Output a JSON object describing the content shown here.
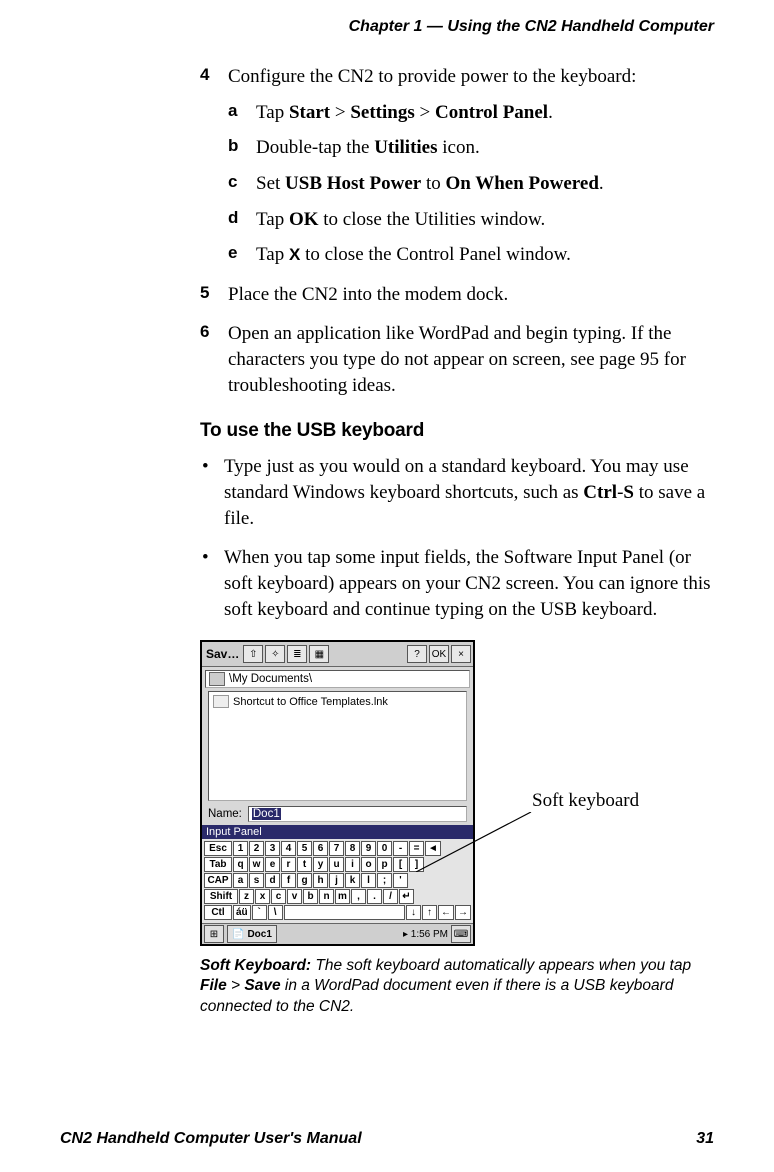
{
  "header": "Chapter 1 — Using the CN2 Handheld Computer",
  "steps": {
    "s4": {
      "num": "4",
      "text_pre": "Configure the CN2 to provide power to the keyboard:",
      "a": {
        "letter": "a",
        "t1": "Tap ",
        "b1": "Start",
        "t2": " > ",
        "b2": "Settings",
        "t3": " > ",
        "b3": "Control Panel",
        "t4": "."
      },
      "b": {
        "letter": "b",
        "t1": "Double-tap the ",
        "b1": "Utilities",
        "t2": " icon."
      },
      "c": {
        "letter": "c",
        "t1": "Set ",
        "b1": "USB Host Power",
        "t2": " to ",
        "b2": "On When Powered",
        "t3": "."
      },
      "d": {
        "letter": "d",
        "t1": "Tap ",
        "b1": "OK",
        "t2": " to close the Utilities window."
      },
      "e": {
        "letter": "e",
        "t1": "Tap ",
        "icon": "X",
        "t2": " to close the Control Panel window."
      }
    },
    "s5": {
      "num": "5",
      "text": "Place the CN2 into the modem dock."
    },
    "s6": {
      "num": "6",
      "text": "Open an application like WordPad and begin typing. If the characters you type do not appear on screen, see page 95 for troubleshooting ideas."
    }
  },
  "section_heading": "To use the USB keyboard",
  "bullets": {
    "b1": {
      "t1": "Type just as you would on a standard keyboard. You may use standard Windows keyboard shortcuts, such as ",
      "bold": "Ctrl",
      "t2": "-",
      "bold2": "S",
      "t3": " to save a file."
    },
    "b2": "When you tap some input fields, the Software Input Panel (or soft keyboard) appears on your CN2 screen. You can ignore this soft keyboard and continue typing on the USB keyboard."
  },
  "callout": "Soft keyboard",
  "screenshot": {
    "title": "Sav…",
    "btn_q": "?",
    "btn_ok": "OK",
    "btn_x": "×",
    "path": "\\My Documents\\",
    "file": "Shortcut to Office Templates.lnk",
    "name_label": "Name:",
    "name_value": "Doc1",
    "sip_title": "Input Panel",
    "keys": {
      "r1": [
        "Esc",
        "1",
        "2",
        "3",
        "4",
        "5",
        "6",
        "7",
        "8",
        "9",
        "0",
        "-",
        "=",
        "◄"
      ],
      "r2": [
        "Tab",
        "q",
        "w",
        "e",
        "r",
        "t",
        "y",
        "u",
        "i",
        "o",
        "p",
        "[",
        "]"
      ],
      "r3": [
        "CAP",
        "a",
        "s",
        "d",
        "f",
        "g",
        "h",
        "j",
        "k",
        "l",
        ";",
        "'"
      ],
      "r4": [
        "Shift",
        "z",
        "x",
        "c",
        "v",
        "b",
        "n",
        "m",
        ",",
        ".",
        "/",
        "↵"
      ],
      "r5": [
        "Ctl",
        "áü",
        "`",
        "\\",
        " ",
        " ",
        "↓",
        "↑",
        "←",
        "→"
      ]
    },
    "task_doc": "Doc1",
    "task_time": "▸ 1:56 PM"
  },
  "caption": {
    "lead": "Soft Keyboard:",
    "t1": " The soft keyboard automatically appears when you tap ",
    "b1": "File",
    "t2": " > ",
    "b2": "Save",
    "t3": " in a WordPad document even if there is a USB keyboard connected to the CN2."
  },
  "footer": {
    "left": "CN2 Handheld Computer User's Manual",
    "right": "31"
  }
}
